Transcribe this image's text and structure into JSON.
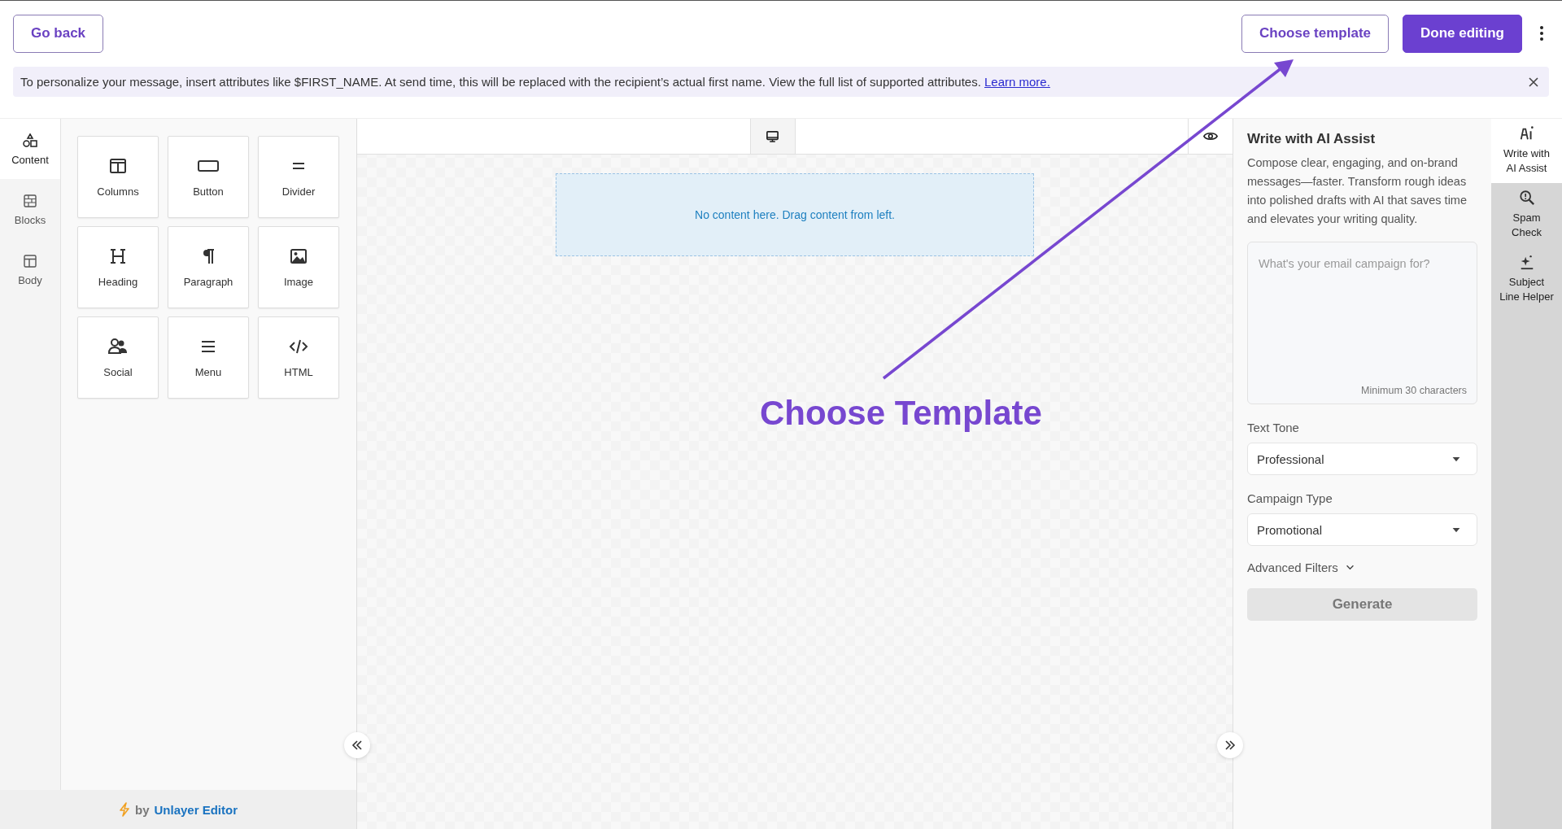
{
  "header": {
    "back_button": "Go back",
    "template_button": "Choose template",
    "done_button": "Done editing"
  },
  "banner": {
    "text": "To personalize your message, insert attributes like $FIRST_NAME. At send time, this will be replaced with the recipient’s actual first name. View the full list of supported attributes.",
    "link": "Learn more."
  },
  "left_tabs": [
    {
      "label": "Content",
      "selected": true
    },
    {
      "label": "Blocks",
      "selected": false
    },
    {
      "label": "Body",
      "selected": false
    }
  ],
  "tools": [
    "Columns",
    "Button",
    "Divider",
    "Heading",
    "Paragraph",
    "Image",
    "Social",
    "Menu",
    "HTML"
  ],
  "canvas": {
    "empty_message": "No content here. Drag content from left."
  },
  "footer": {
    "by": "by",
    "brand": "Unlayer Editor"
  },
  "ai_panel": {
    "title": "Write with AI Assist",
    "description": "Compose clear, engaging, and on-brand messages—faster. Transform rough ideas into polished drafts with AI that saves time and elevates your writing quality.",
    "prompt": {
      "placeholder": "What's your email campaign for?",
      "hint": "Minimum 30 characters"
    },
    "fields": [
      {
        "label": "Text Tone",
        "value": "Professional"
      },
      {
        "label": "Campaign Type",
        "value": "Promotional"
      }
    ],
    "advanced_filters": "Advanced Filters",
    "generate_button": "Generate"
  },
  "right_tabs": [
    {
      "lines": [
        "Write with",
        "AI Assist"
      ],
      "selected": true
    },
    {
      "lines": [
        "Spam",
        "Check"
      ],
      "selected": false
    },
    {
      "lines": [
        "Subject",
        "Line Helper"
      ],
      "selected": false
    }
  ],
  "annotation": {
    "label": "Choose Template"
  }
}
